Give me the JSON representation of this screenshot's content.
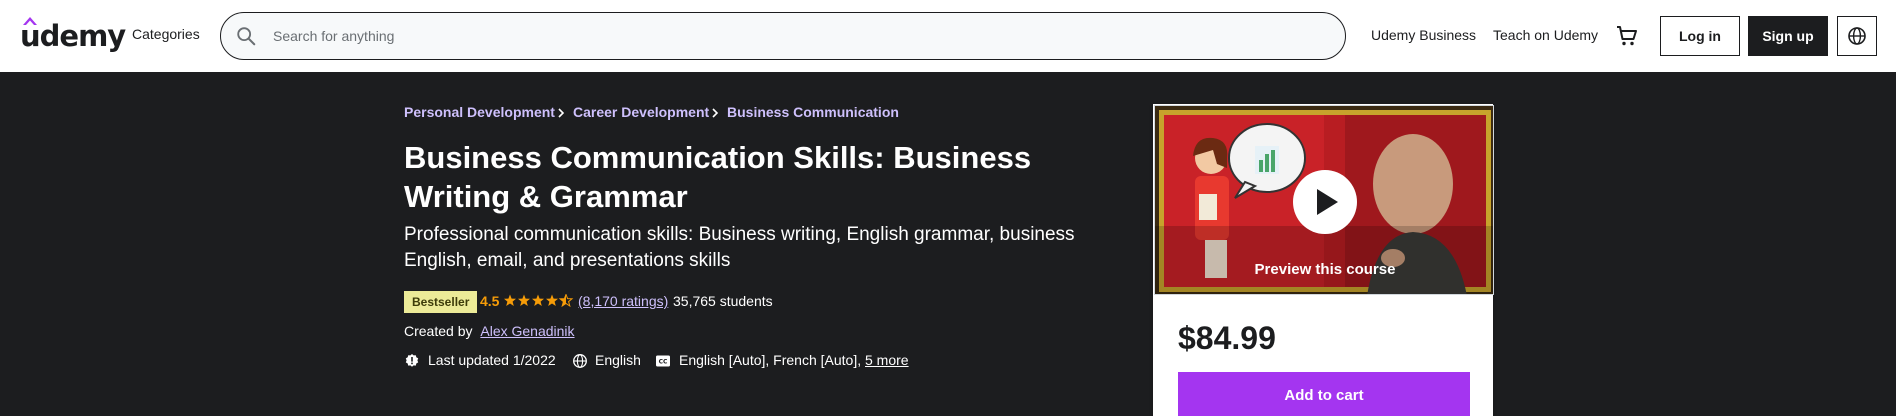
{
  "header": {
    "logo_text": "udemy",
    "categories_label": "Categories",
    "search": {
      "placeholder": "Search for anything",
      "value": ""
    },
    "udemy_business_label": "Udemy Business",
    "teach_label": "Teach on Udemy",
    "cart_icon": "cart-icon",
    "login_label": "Log in",
    "signup_label": "Sign up",
    "language_icon": "globe-icon",
    "brand_color": "#a435f0"
  },
  "breadcrumb": [
    {
      "label": "Personal Development"
    },
    {
      "label": "Career Development"
    },
    {
      "label": "Business Communication"
    }
  ],
  "course": {
    "title": "Business Communication Skills: Business Writing & Grammar",
    "subtitle": "Professional communication skills: Business writing, English grammar, business English, email, and presentations skills",
    "badge": "Bestseller",
    "rating": "4.5",
    "rating_value": 4.5,
    "rating_count": "(8,170 ratings)",
    "students": "35,765 students",
    "created_by_label": "Created by",
    "author": "Alex Genadinik",
    "last_updated": "Last updated 1/2022",
    "language": "English",
    "captions": "English [Auto], French [Auto],",
    "captions_more": "5 more"
  },
  "card": {
    "preview_label": "Preview this course",
    "price": "$84.99",
    "add_to_cart_label": "Add to cart"
  }
}
